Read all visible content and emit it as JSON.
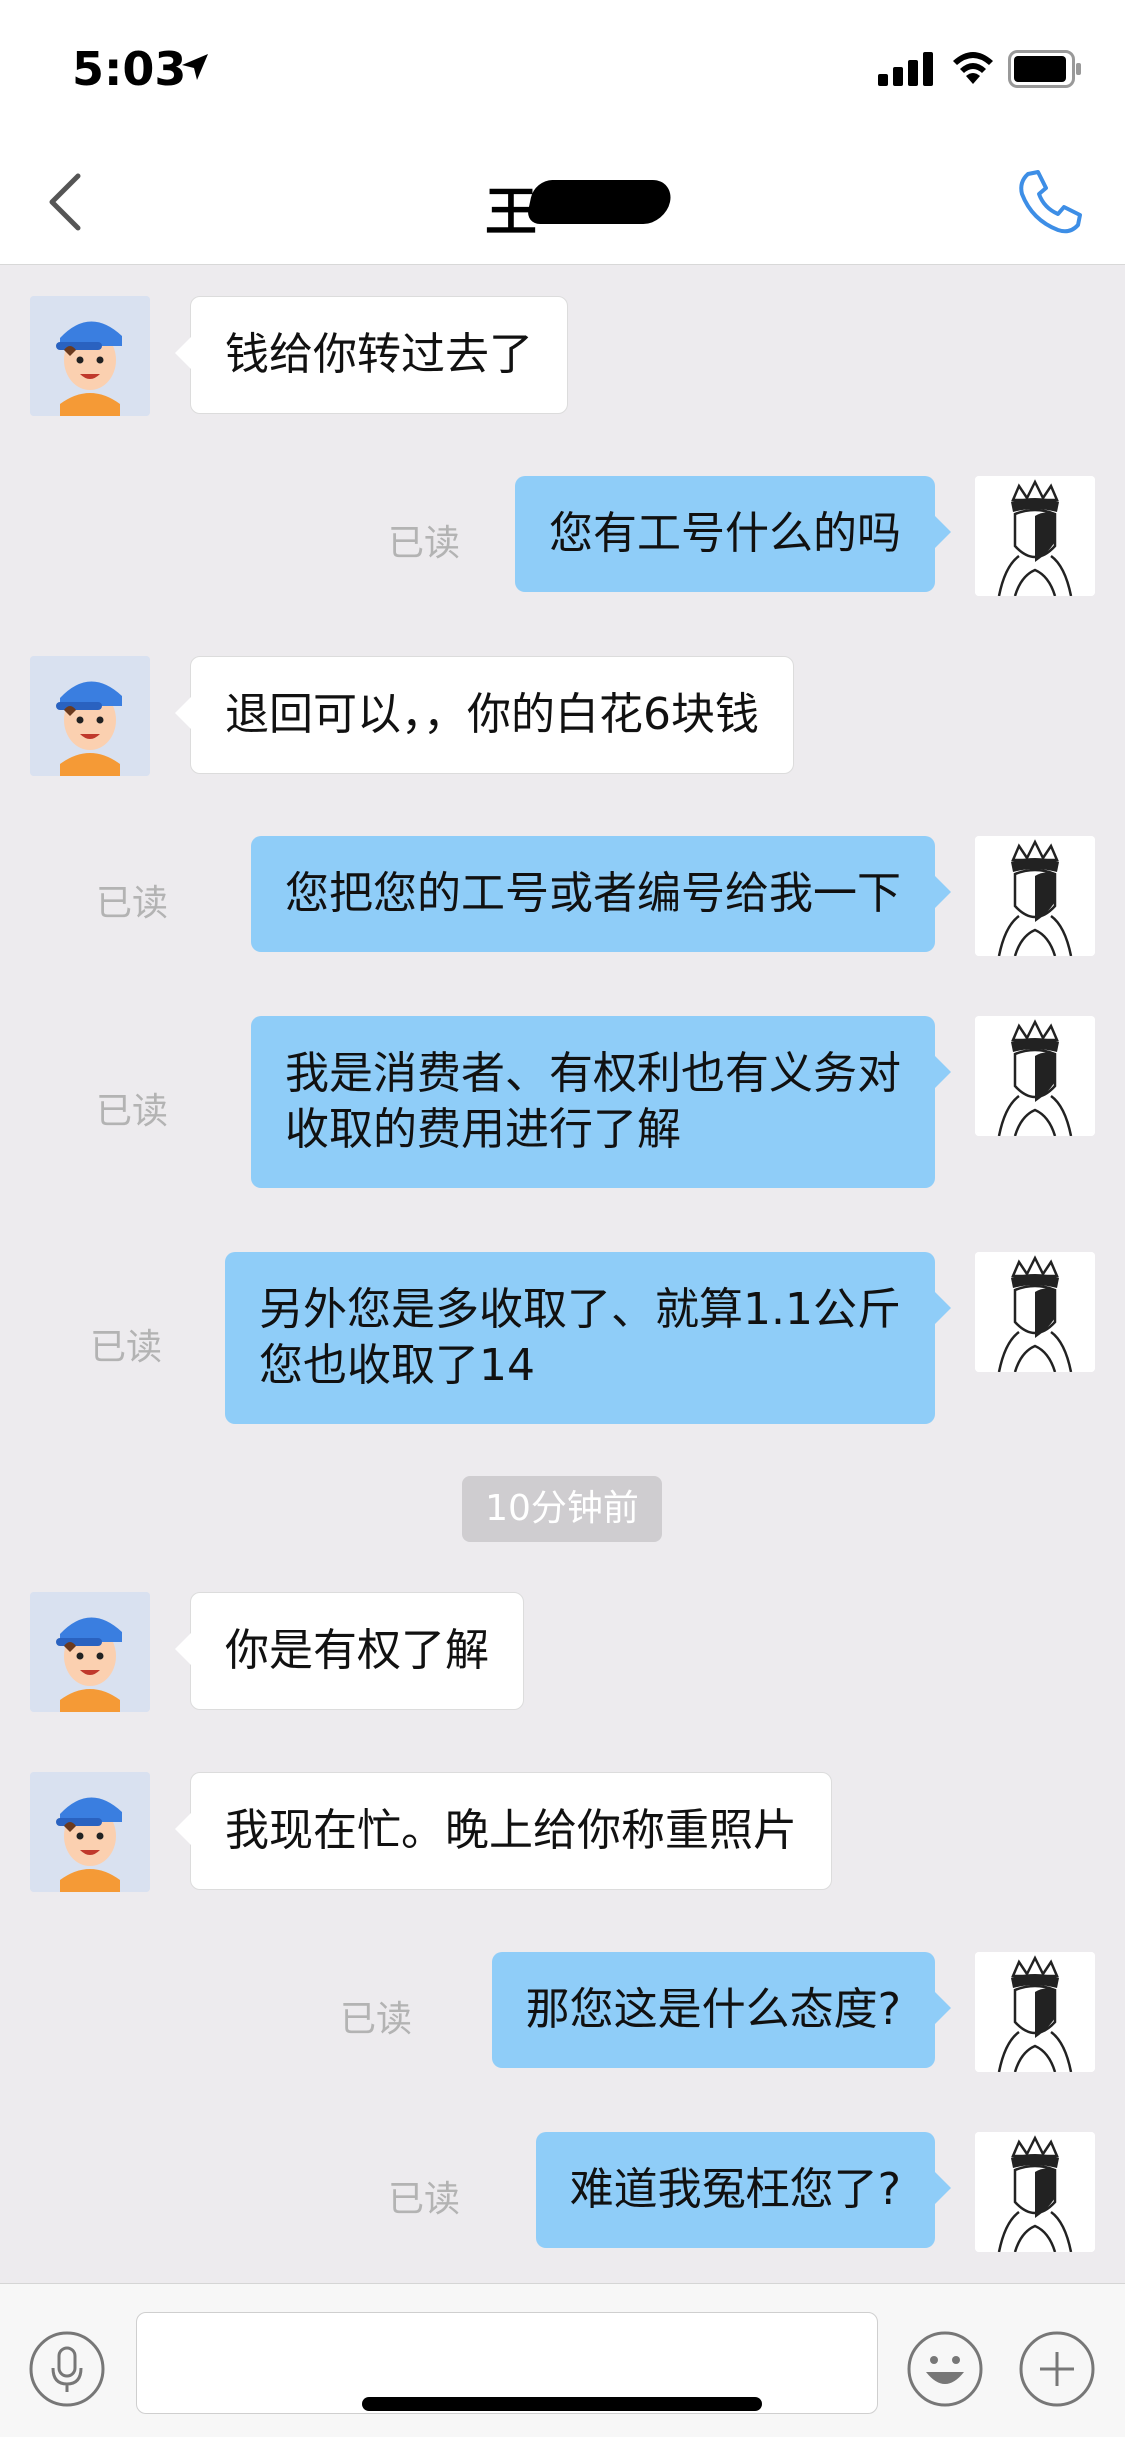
{
  "status_bar": {
    "time": "5:03"
  },
  "nav": {
    "title": "王"
  },
  "messages": [
    {
      "side": "in",
      "text": "钱给你转过去了"
    },
    {
      "side": "out",
      "text": "您有工号什么的吗",
      "read": "已读"
    },
    {
      "side": "in",
      "text": "退回可以，，你的白花6块钱"
    },
    {
      "side": "out",
      "text": "您把您的工号或者编号给我一下",
      "read": "已读"
    },
    {
      "side": "out",
      "text": "我是消费者、有权利也有义务对",
      "text2": "收取的费用进行了解",
      "read": "已读"
    },
    {
      "side": "out",
      "text": "另外您是多收取了、就算1.1公斤",
      "text2": "您也收取了14",
      "read": "已读"
    },
    {
      "side": "in",
      "text": "你是有权了解"
    },
    {
      "side": "in",
      "text": "我现在忙。晚上给你称重照片"
    },
    {
      "side": "out",
      "text": "那您这是什么态度?",
      "read": "已读"
    },
    {
      "side": "out",
      "text": "难道我冤枉您了?",
      "read": "已读"
    }
  ],
  "timestamp": "10分钟前",
  "input": {
    "placeholder": ""
  },
  "icons": {
    "back": "chevron-left-icon",
    "call": "phone-icon",
    "mic": "microphone-icon",
    "emoji": "smiley-icon",
    "plus": "plus-icon"
  },
  "colors": {
    "accent": "#3d8ee6",
    "out_bubble": "#8fcdf8",
    "background": "#edebee"
  }
}
